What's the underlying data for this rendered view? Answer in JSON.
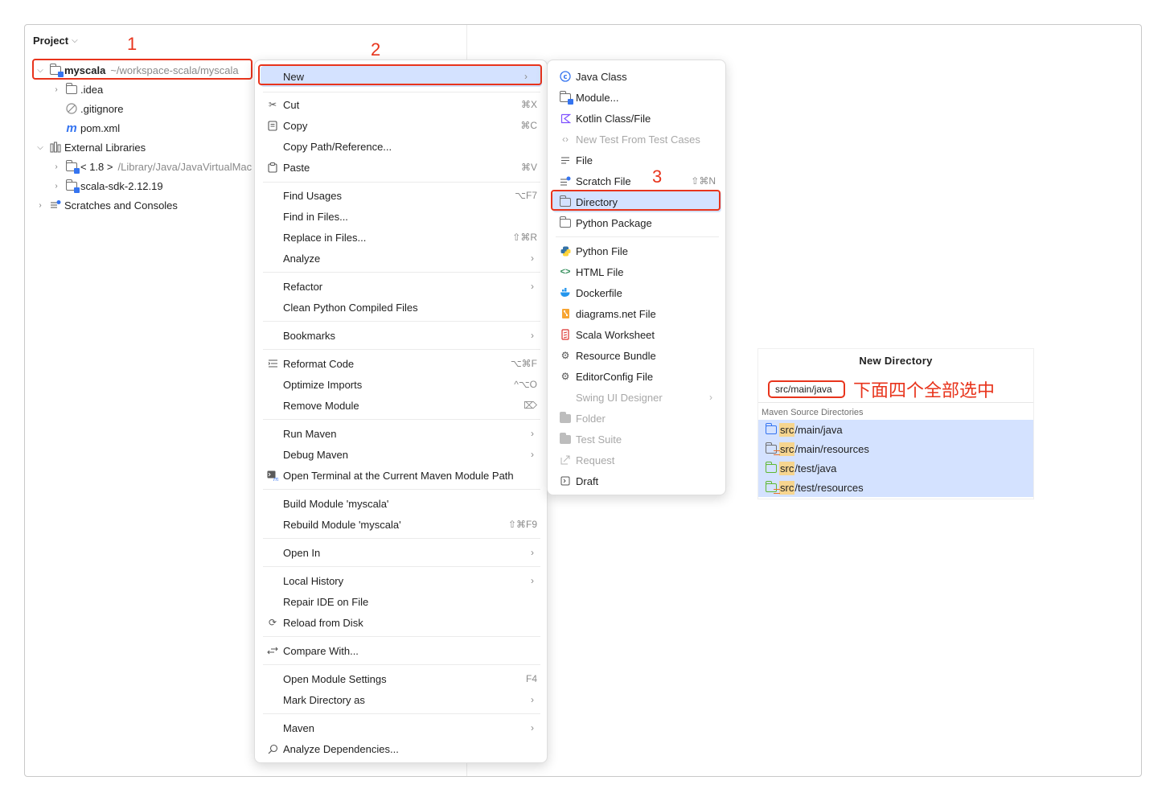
{
  "project_panel": {
    "header": "Project",
    "tree": [
      {
        "label": "myscala",
        "path": "~/workspace-scala/myscala"
      },
      {
        "label": ".idea"
      },
      {
        "label": ".gitignore"
      },
      {
        "label": "pom.xml"
      },
      {
        "label": "External Libraries"
      },
      {
        "label": "< 1.8 >",
        "path": "/Library/Java/JavaVirtualMac"
      },
      {
        "label": "scala-sdk-2.12.19"
      },
      {
        "label": "Scratches and Consoles"
      }
    ]
  },
  "annotations": {
    "step1": "1",
    "step2": "2",
    "step3": "3",
    "select_all_note": "下面四个全部选中"
  },
  "context_menu": {
    "items": [
      {
        "label": "New",
        "shortcut": ""
      },
      {
        "label": "Cut",
        "shortcut": "⌘X"
      },
      {
        "label": "Copy",
        "shortcut": "⌘C"
      },
      {
        "label": "Copy Path/Reference...",
        "shortcut": ""
      },
      {
        "label": "Paste",
        "shortcut": "⌘V"
      },
      {
        "label": "Find Usages",
        "shortcut": "⌥F7"
      },
      {
        "label": "Find in Files...",
        "shortcut": ""
      },
      {
        "label": "Replace in Files...",
        "shortcut": "⇧⌘R"
      },
      {
        "label": "Analyze",
        "shortcut": ""
      },
      {
        "label": "Refactor",
        "shortcut": ""
      },
      {
        "label": "Clean Python Compiled Files",
        "shortcut": ""
      },
      {
        "label": "Bookmarks",
        "shortcut": ""
      },
      {
        "label": "Reformat Code",
        "shortcut": "⌥⌘F"
      },
      {
        "label": "Optimize Imports",
        "shortcut": "^⌥O"
      },
      {
        "label": "Remove Module",
        "shortcut": "⌦"
      },
      {
        "label": "Run Maven",
        "shortcut": ""
      },
      {
        "label": "Debug Maven",
        "shortcut": ""
      },
      {
        "label": "Open Terminal at the Current Maven Module Path",
        "shortcut": ""
      },
      {
        "label": "Build Module 'myscala'",
        "shortcut": ""
      },
      {
        "label": "Rebuild Module 'myscala'",
        "shortcut": "⇧⌘F9"
      },
      {
        "label": "Open In",
        "shortcut": ""
      },
      {
        "label": "Local History",
        "shortcut": ""
      },
      {
        "label": "Repair IDE on File",
        "shortcut": ""
      },
      {
        "label": "Reload from Disk",
        "shortcut": ""
      },
      {
        "label": "Compare With...",
        "shortcut": ""
      },
      {
        "label": "Open Module Settings",
        "shortcut": "F4"
      },
      {
        "label": "Mark Directory as",
        "shortcut": ""
      },
      {
        "label": "Maven",
        "shortcut": ""
      },
      {
        "label": "Analyze Dependencies...",
        "shortcut": ""
      }
    ]
  },
  "new_submenu": {
    "items": [
      {
        "label": "Java Class",
        "shortcut": ""
      },
      {
        "label": "Module...",
        "shortcut": ""
      },
      {
        "label": "Kotlin Class/File",
        "shortcut": ""
      },
      {
        "label": "New Test From Test Cases",
        "shortcut": ""
      },
      {
        "label": "File",
        "shortcut": ""
      },
      {
        "label": "Scratch File",
        "shortcut": "⇧⌘N"
      },
      {
        "label": "Directory",
        "shortcut": ""
      },
      {
        "label": "Python Package",
        "shortcut": ""
      },
      {
        "label": "Python File",
        "shortcut": ""
      },
      {
        "label": "HTML File",
        "shortcut": ""
      },
      {
        "label": "Dockerfile",
        "shortcut": ""
      },
      {
        "label": "diagrams.net File",
        "shortcut": ""
      },
      {
        "label": "Scala Worksheet",
        "shortcut": ""
      },
      {
        "label": "Resource Bundle",
        "shortcut": ""
      },
      {
        "label": "EditorConfig File",
        "shortcut": ""
      },
      {
        "label": "Swing UI Designer",
        "shortcut": ""
      },
      {
        "label": "Folder",
        "shortcut": ""
      },
      {
        "label": "Test Suite",
        "shortcut": ""
      },
      {
        "label": "Request",
        "shortcut": ""
      },
      {
        "label": "Draft",
        "shortcut": ""
      }
    ]
  },
  "new_directory": {
    "title": "New Directory",
    "input_value": "src/main/java",
    "section_label": "Maven Source Directories",
    "suggestions": [
      {
        "prefix": "src",
        "rest": "/main/java"
      },
      {
        "prefix": "src",
        "rest": "/main/resources"
      },
      {
        "prefix": "src",
        "rest": "/test/java"
      },
      {
        "prefix": "src",
        "rest": "/test/resources"
      }
    ]
  },
  "colors": {
    "accent": "#3574f0",
    "highlight": "#d4e2ff",
    "annotation_red": "#e8341c",
    "match_highlight": "#f6d58f"
  }
}
